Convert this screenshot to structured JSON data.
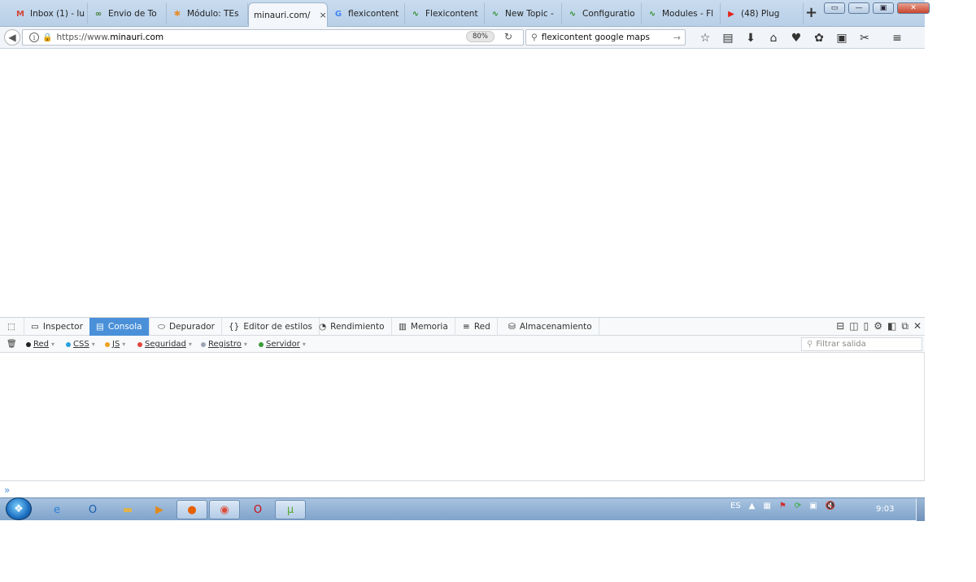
{
  "browser": {
    "tabs": [
      {
        "title": "Inbox (1) - lu",
        "icon": "gmail-icon",
        "color": "#d44638",
        "glyph": "M"
      },
      {
        "title": "Envio de To",
        "icon": "shipping-icon",
        "color": "#3a7a2a",
        "glyph": "∞"
      },
      {
        "title": "Módulo: TEs",
        "icon": "joomla-icon",
        "color": "#e58c2a",
        "glyph": "✱"
      },
      {
        "title": "minauri.com/",
        "icon": "",
        "color": "#ffffff",
        "glyph": "",
        "active": true
      },
      {
        "title": "flexicontent",
        "icon": "google-icon",
        "color": "#4285f4",
        "glyph": "G"
      },
      {
        "title": "Flexicontent",
        "icon": "flexicontent-icon",
        "color": "#2f8f2f",
        "glyph": "∿"
      },
      {
        "title": "New Topic -",
        "icon": "flexicontent-icon",
        "color": "#2f8f2f",
        "glyph": "∿"
      },
      {
        "title": "Configuratio",
        "icon": "flexicontent-icon",
        "color": "#2f8f2f",
        "glyph": "∿"
      },
      {
        "title": "Modules - Fl",
        "icon": "flexicontent-icon",
        "color": "#2f8f2f",
        "glyph": "∿"
      },
      {
        "title": "(48) Plug",
        "icon": "youtube-icon",
        "color": "#e62117",
        "glyph": "▶"
      }
    ],
    "tab_close_glyph": "×",
    "new_tab_glyph": "+",
    "url_prefix": "https://www.",
    "url_domain": "minauri.com",
    "zoom": "80%",
    "search_query": "flexicontent google maps",
    "nav_icons": [
      {
        "name": "bookmark-star-icon",
        "glyph": "☆"
      },
      {
        "name": "reading-list-icon",
        "glyph": "▤"
      },
      {
        "name": "download-icon",
        "glyph": "⬇"
      },
      {
        "name": "home-icon",
        "glyph": "⌂"
      },
      {
        "name": "pocket-icon",
        "glyph": "♥"
      },
      {
        "name": "extension-icon",
        "glyph": "✿"
      },
      {
        "name": "screen-icon",
        "glyph": "▣"
      },
      {
        "name": "puzzle-icon",
        "glyph": "✂"
      },
      {
        "name": "hamburger-menu-icon",
        "glyph": "≡"
      }
    ]
  },
  "devtools": {
    "tabs": [
      {
        "label": "Inspector",
        "icon": "inspector-icon",
        "glyph": "▭"
      },
      {
        "label": "Consola",
        "icon": "console-icon",
        "glyph": "▤",
        "active": true
      },
      {
        "label": "Depurador",
        "icon": "debugger-icon",
        "glyph": "⬭"
      },
      {
        "label": "Editor de estilos",
        "icon": "style-editor-icon",
        "glyph": "{}"
      },
      {
        "label": "Rendimiento",
        "icon": "performance-icon",
        "glyph": "◔"
      },
      {
        "label": "Memoria",
        "icon": "memory-icon",
        "glyph": "▥"
      },
      {
        "label": "Red",
        "icon": "network-icon",
        "glyph": "≡"
      },
      {
        "label": "Almacenamiento",
        "icon": "storage-icon",
        "glyph": "⛁"
      }
    ],
    "filters": [
      {
        "label": "Red",
        "color": "#222222"
      },
      {
        "label": "CSS",
        "color": "#2aa0e0"
      },
      {
        "label": "JS",
        "color": "#f0a020"
      },
      {
        "label": "Seguridad",
        "color": "#e0453c"
      },
      {
        "label": "Registro",
        "color": "#9aa5b1"
      },
      {
        "label": "Servidor",
        "color": "#3a9a3a"
      }
    ],
    "filter_placeholder": "Filtrar salida",
    "prompt_glyph": "»"
  },
  "taskbar": {
    "language": "ES",
    "clock": "9:03",
    "apps": [
      {
        "name": "ie-icon",
        "glyph": "e",
        "color": "#2d7fd6"
      },
      {
        "name": "outlook-icon",
        "glyph": "O",
        "color": "#1a5fa8"
      },
      {
        "name": "explorer-icon",
        "glyph": "▬",
        "color": "#e2b24a"
      },
      {
        "name": "media-player-icon",
        "glyph": "▶",
        "color": "#e08a1e"
      },
      {
        "name": "firefox-icon",
        "glyph": "●",
        "color": "#e66000",
        "open": true
      },
      {
        "name": "chrome-icon",
        "glyph": "◉",
        "color": "#dd4b39",
        "open": true
      },
      {
        "name": "opera-icon",
        "glyph": "O",
        "color": "#cc0f16"
      },
      {
        "name": "utorrent-icon",
        "glyph": "µ",
        "color": "#5aa832",
        "open": true
      }
    ]
  },
  "colors": {
    "accent": "#4a90d9",
    "tabstrip": "#c9dcef",
    "taskbar": "#7fa3cb"
  }
}
